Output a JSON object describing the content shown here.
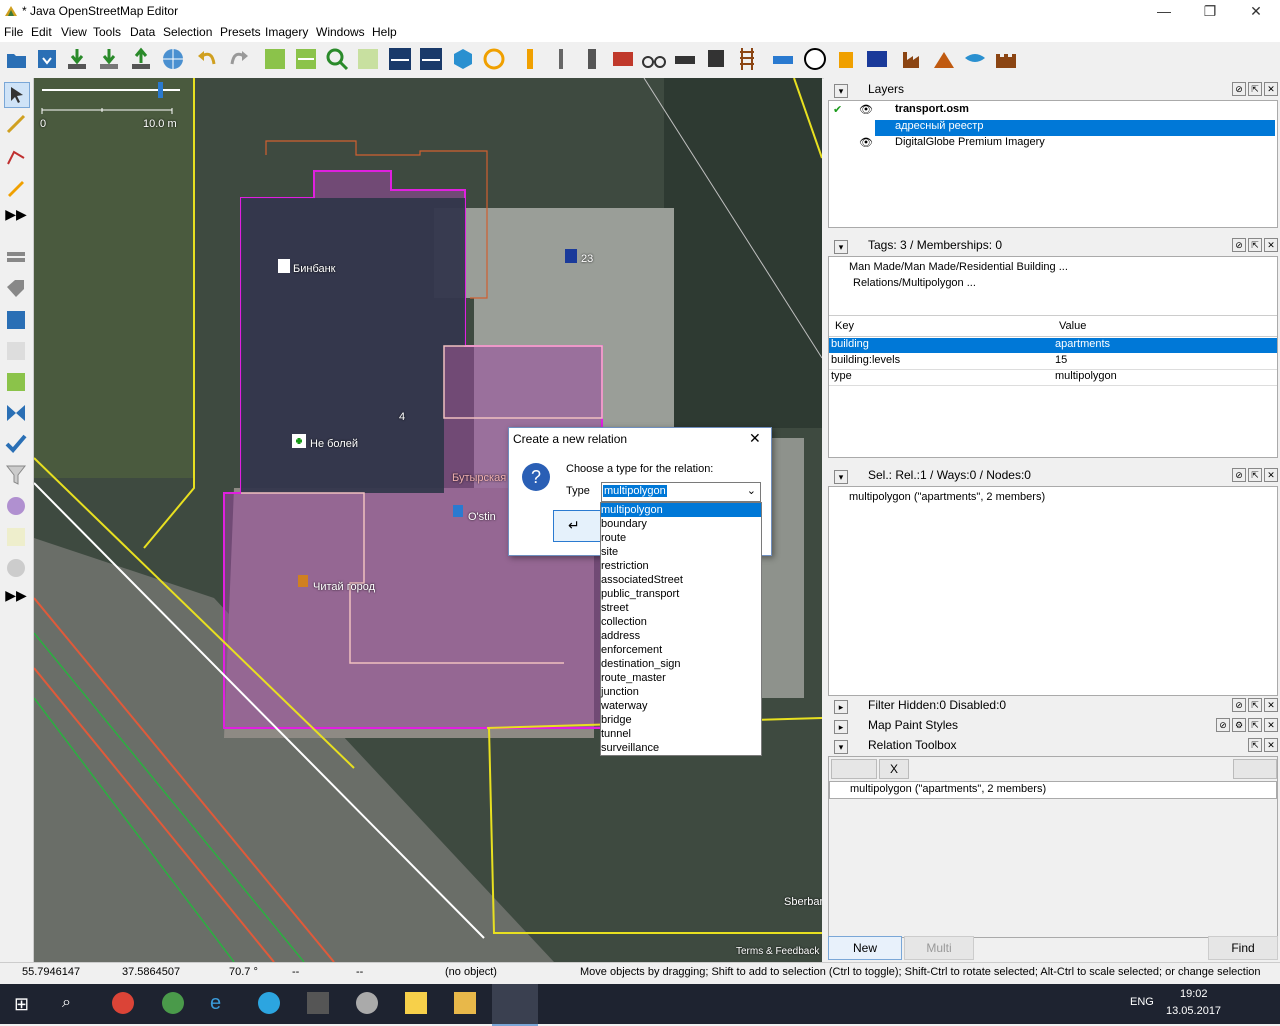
{
  "window": {
    "title": "* Java OpenStreetMap Editor",
    "minimize": "—",
    "maximize": "❐",
    "close": "✕"
  },
  "menu": [
    "File",
    "Edit",
    "View",
    "Tools",
    "Data",
    "Selection",
    "Presets",
    "Imagery",
    "Windows",
    "Help"
  ],
  "scale": {
    "zero": "0",
    "end": "10.0 m"
  },
  "map_labels": {
    "binbank": "Бинбанк",
    "parking": "23",
    "ne_bolei": "Не болей",
    "number": "4",
    "butyrskaya": "Бутырская",
    "ostin": "O'stin",
    "chitai": "Читай город",
    "sberbank": "Sberbar",
    "terms": "Terms & Feedback"
  },
  "layers": {
    "title": "Layers",
    "items": [
      {
        "name": "transport.osm"
      },
      {
        "name": "адресный реестр"
      },
      {
        "name": "DigitalGlobe Premium Imagery"
      }
    ]
  },
  "tags": {
    "title": "Tags: 3 / Memberships: 0",
    "preset1": "Man Made/Man Made/Residential Building ...",
    "preset2": "Relations/Multipolygon ...",
    "col_key": "Key",
    "col_value": "Value",
    "rows": [
      {
        "key": "building",
        "value": "apartments"
      },
      {
        "key": "building:levels",
        "value": "15"
      },
      {
        "key": "type",
        "value": "multipolygon"
      }
    ]
  },
  "selection": {
    "title": "Sel.: Rel.:1 / Ways:0 / Nodes:0",
    "item": "multipolygon (\"apartments\", 2 members)"
  },
  "filter": {
    "title": "Filter Hidden:0 Disabled:0"
  },
  "paintstyles": {
    "title": "Map Paint Styles"
  },
  "toolbox": {
    "title": "Relation Toolbox",
    "item": "multipolygon (\"apartments\", 2 members)",
    "x_label": "X"
  },
  "bottom_buttons": {
    "new": "New",
    "multi": "Multi",
    "find": "Find"
  },
  "status": {
    "lat": "55.7946147",
    "lon": "37.5864507",
    "heading": "70.7 °",
    "angle": "--",
    "dist": "--",
    "object": "(no object)",
    "help": "Move objects by dragging; Shift to add to selection (Ctrl to toggle); Shift-Ctrl to rotate selected; Alt-Ctrl to scale selected; or change selection"
  },
  "dialog": {
    "title": "Create a new relation",
    "prompt": "Choose a type for the relation:",
    "type_label": "Type",
    "type_value": "multipolygon",
    "close": "✕",
    "options": [
      "multipolygon",
      "boundary",
      "route",
      "site",
      "restriction",
      "associatedStreet",
      "public_transport",
      "street",
      "collection",
      "address",
      "enforcement",
      "destination_sign",
      "route_master",
      "junction",
      "waterway",
      "bridge",
      "tunnel",
      "surveillance"
    ]
  },
  "taskbar": {
    "lang": "ENG",
    "time": "19:02",
    "date": "13.05.2017"
  },
  "colors": {
    "selection_blue": "#0078d7",
    "multipolygon_magenta": "#e020e0",
    "way_yellow": "#e8e020",
    "taskbar": "#1e2330"
  }
}
